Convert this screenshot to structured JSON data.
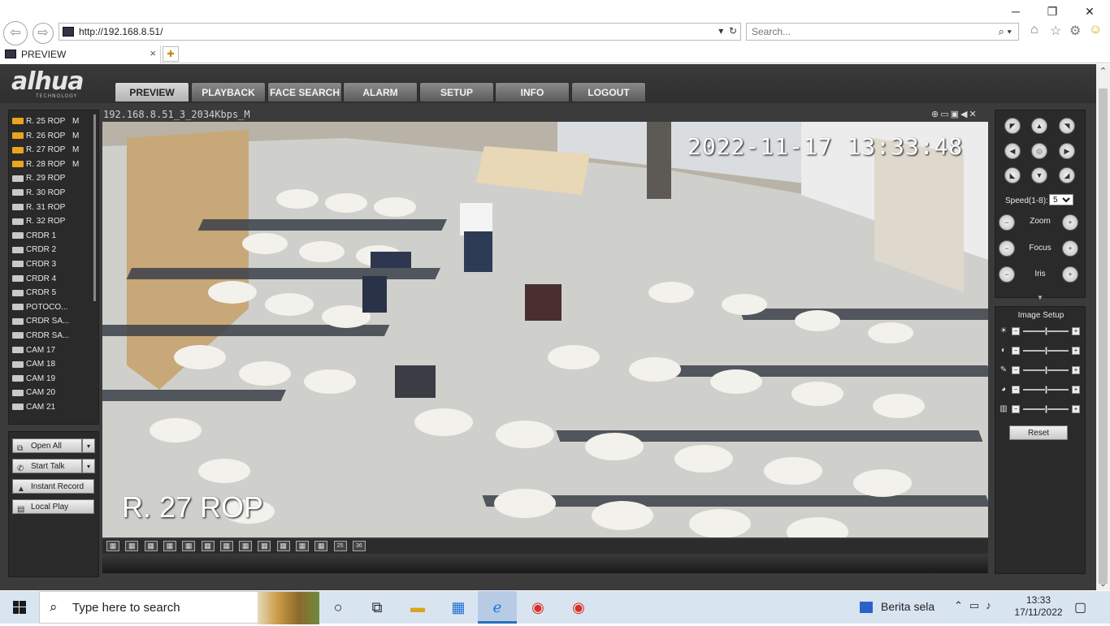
{
  "browser": {
    "url": "http://192.168.8.51/",
    "search_placeholder": "Search...",
    "tab_title": "PREVIEW",
    "window_controls": {
      "minimize": "─",
      "restore": "❐",
      "close": "✕"
    }
  },
  "app": {
    "logo_text": "alhua",
    "logo_sub": "TECHNOLOGY",
    "menu": [
      "PREVIEW",
      "PLAYBACK",
      "FACE SEARCH",
      "ALARM",
      "SETUP",
      "INFO",
      "LOGOUT"
    ],
    "active_menu": "PREVIEW"
  },
  "channels": [
    {
      "name": "R. 25 ROP",
      "mark": "M",
      "active": true
    },
    {
      "name": "R. 26 ROP",
      "mark": "M",
      "active": true
    },
    {
      "name": "R. 27 ROP",
      "mark": "M",
      "active": true
    },
    {
      "name": "R. 28 ROP",
      "mark": "M",
      "active": true
    },
    {
      "name": "R. 29 ROP",
      "mark": "",
      "active": false
    },
    {
      "name": "R. 30 ROP",
      "mark": "",
      "active": false
    },
    {
      "name": "R. 31 ROP",
      "mark": "",
      "active": false
    },
    {
      "name": "R. 32 ROP",
      "mark": "",
      "active": false
    },
    {
      "name": "CRDR 1",
      "mark": "",
      "active": false
    },
    {
      "name": "CRDR 2",
      "mark": "",
      "active": false
    },
    {
      "name": "CRDR 3",
      "mark": "",
      "active": false
    },
    {
      "name": "CRDR 4",
      "mark": "",
      "active": false
    },
    {
      "name": "CRDR 5",
      "mark": "",
      "active": false
    },
    {
      "name": "POTOCO...",
      "mark": "",
      "active": false
    },
    {
      "name": "CRDR SA...",
      "mark": "",
      "active": false
    },
    {
      "name": "CRDR SA...",
      "mark": "",
      "active": false
    },
    {
      "name": "CAM 17",
      "mark": "",
      "active": false
    },
    {
      "name": "CAM 18",
      "mark": "",
      "active": false
    },
    {
      "name": "CAM 19",
      "mark": "",
      "active": false
    },
    {
      "name": "CAM 20",
      "mark": "",
      "active": false
    },
    {
      "name": "CAM 21",
      "mark": "",
      "active": false
    }
  ],
  "controls": {
    "open_all": "Open All",
    "start_talk": "Start Talk",
    "instant_record": "Instant Record",
    "local_play": "Local Play"
  },
  "video": {
    "stream_label": "192.168.8.51_3_2034Kbps_M",
    "osd_time": "2022-11-17 13:33:48",
    "osd_name": "R. 27 ROP",
    "layout_buttons": [
      "1",
      "2",
      "3",
      "4",
      "5",
      "6",
      "7",
      "8",
      "9",
      "10",
      "11",
      "12",
      "25",
      "36"
    ]
  },
  "ptz": {
    "speed_label": "Speed(1-8):",
    "speed_value": "5",
    "zoom_label": "Zoom",
    "focus_label": "Focus",
    "iris_label": "Iris"
  },
  "image_setup": {
    "title": "Image Setup",
    "sliders": [
      {
        "icon": "brightness-icon",
        "value": 0.5
      },
      {
        "icon": "contrast-icon",
        "value": 0.5
      },
      {
        "icon": "saturation-icon",
        "value": 0.5
      },
      {
        "icon": "hue-icon",
        "value": 0.5
      },
      {
        "icon": "sharpness-icon",
        "value": 0.5
      }
    ],
    "reset_label": "Reset"
  },
  "taskbar": {
    "search_placeholder": "Type here to search",
    "news_label": "Berita sela",
    "time": "13:33",
    "date": "17/11/2022"
  }
}
